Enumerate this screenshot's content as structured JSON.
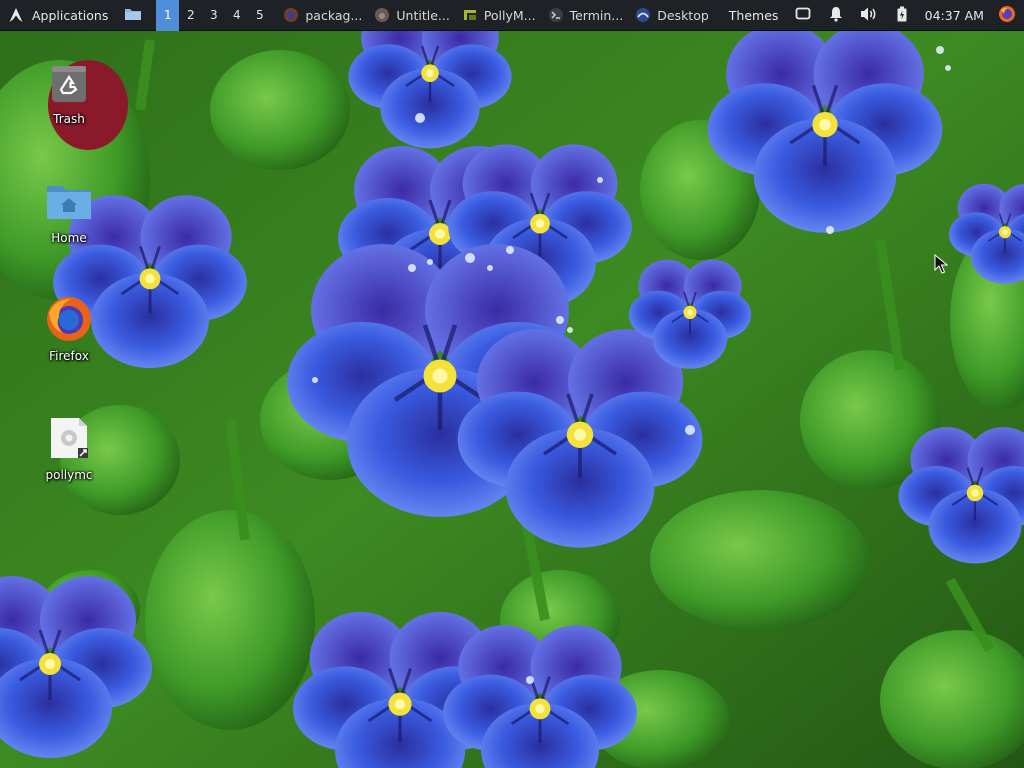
{
  "panel": {
    "applications_label": "Applications",
    "workspaces": [
      "1",
      "2",
      "3",
      "4",
      "5"
    ],
    "active_workspace": "1",
    "tasks": [
      {
        "label": "packag...",
        "icon": "firefox-icon"
      },
      {
        "label": "Untitle...",
        "icon": "gimp-icon"
      },
      {
        "label": "PollyM...",
        "icon": "pollymc-icon"
      },
      {
        "label": "Termin...",
        "icon": "terminal-icon"
      },
      {
        "label": "Desktop",
        "icon": "desktop-icon"
      }
    ],
    "themes_label": "Themes",
    "clock": "04:37 AM",
    "accent_color": "#4f8fd9"
  },
  "desktop": {
    "icons": [
      {
        "label": "Trash",
        "icon": "trash-icon"
      },
      {
        "label": "Home",
        "icon": "home-folder-icon"
      },
      {
        "label": "Firefox",
        "icon": "firefox-icon"
      },
      {
        "label": "pollymc",
        "icon": "pollymc-launcher-icon"
      }
    ]
  }
}
